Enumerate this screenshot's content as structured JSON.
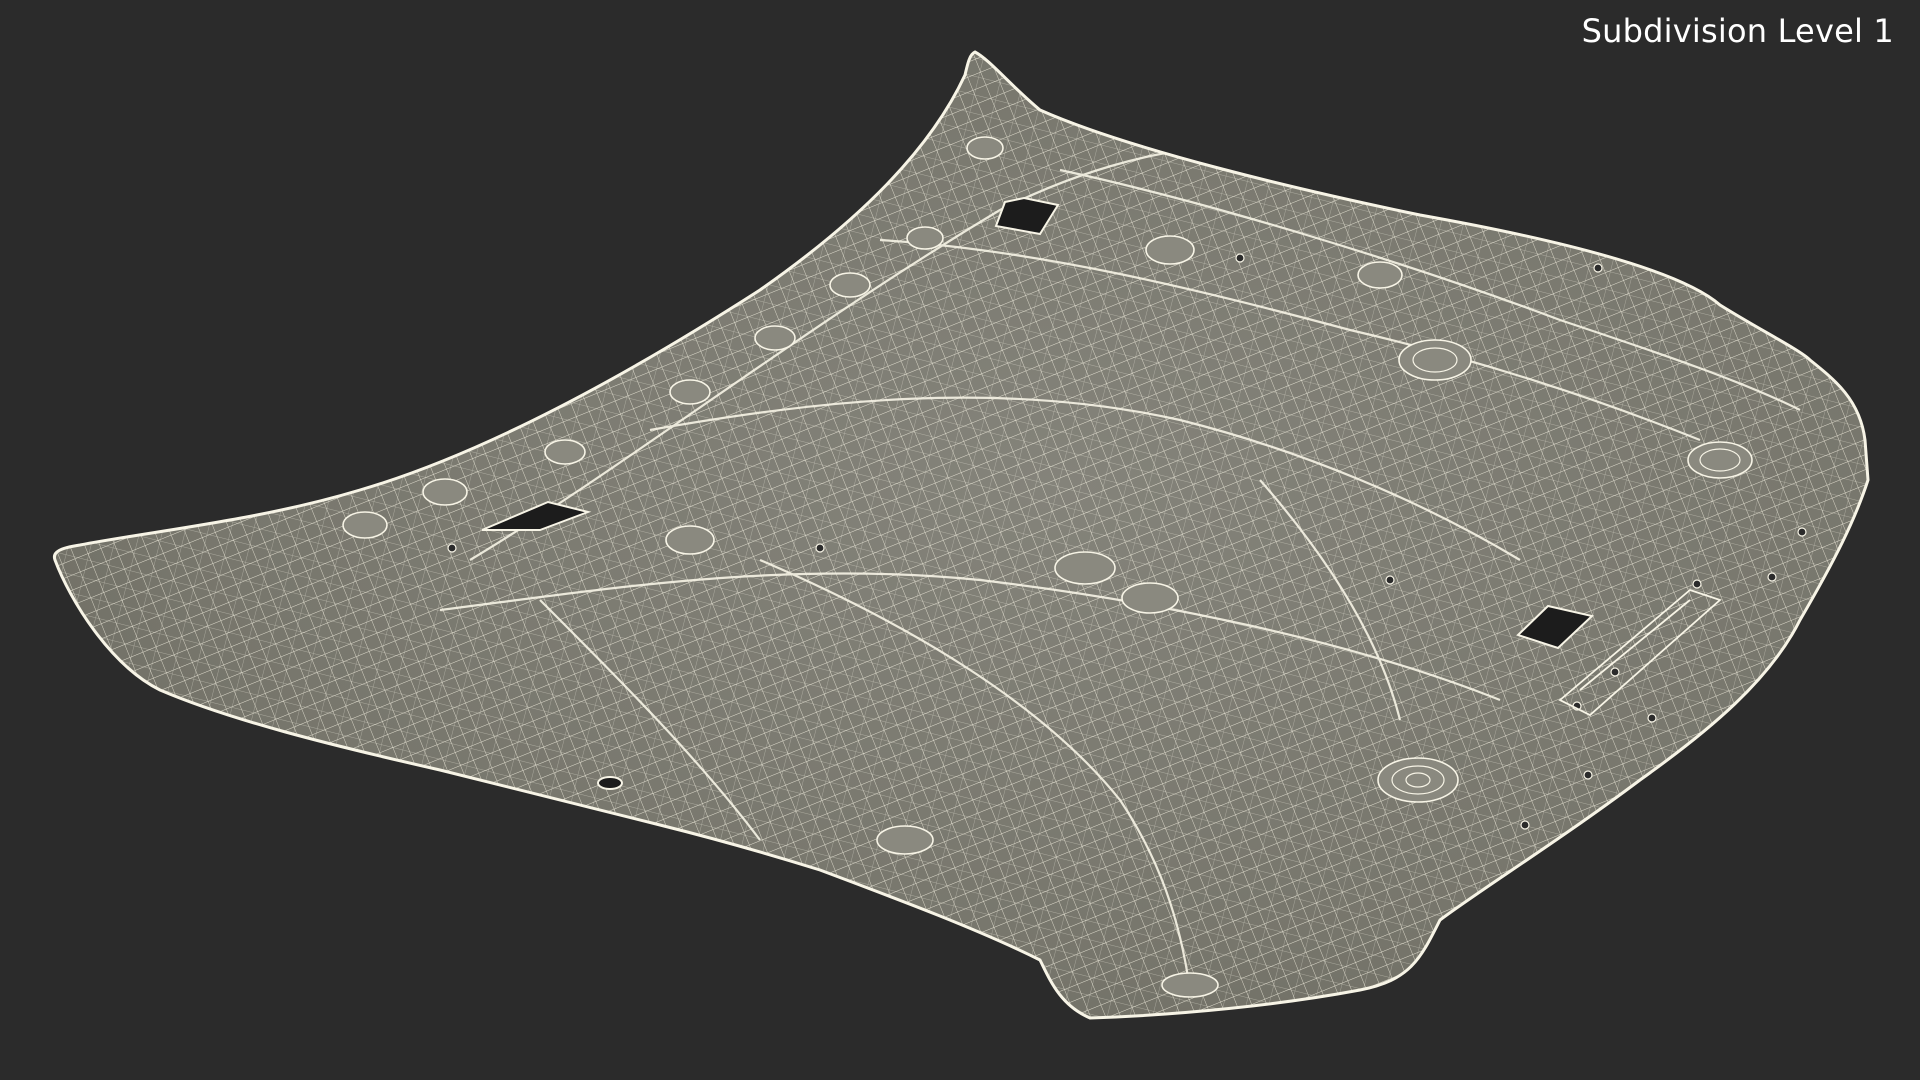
{
  "overlay": {
    "subdivision_label": "Subdivision Level 1"
  },
  "scene": {
    "object": "car-hood-liner-wireframe",
    "background_color": "#2b2b2b",
    "surface_color": "#7b7a6f",
    "wire_color": "#f2efe0",
    "hole_color": "#1a1a1a"
  }
}
